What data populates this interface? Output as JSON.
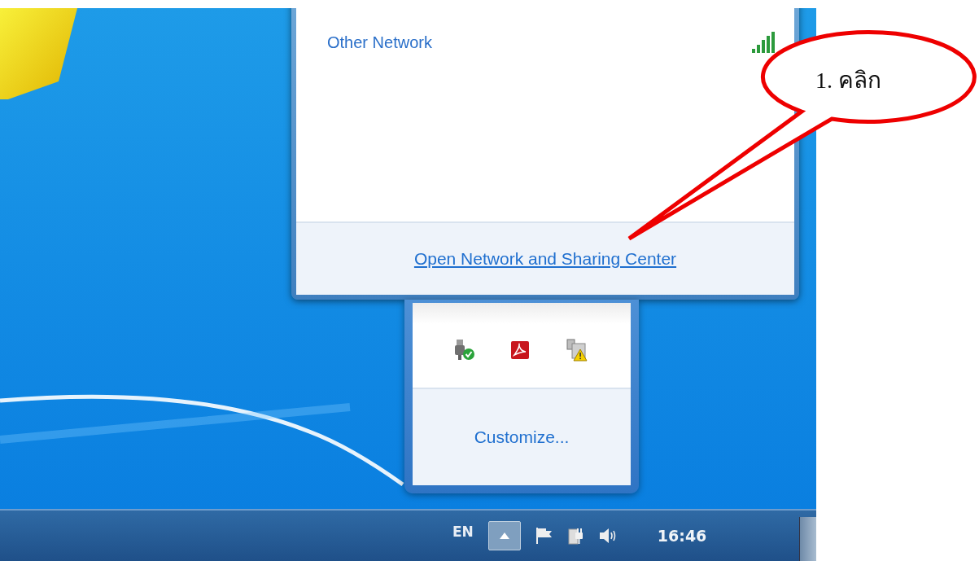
{
  "network_popup": {
    "networks": [
      {
        "name": "Other Network"
      }
    ],
    "footer_link": "Open Network and Sharing Center"
  },
  "overflow_tray": {
    "customize_link": "Customize..."
  },
  "taskbar": {
    "language": "EN",
    "clock": "16:46"
  },
  "callout": {
    "text": "1. คลิก"
  }
}
